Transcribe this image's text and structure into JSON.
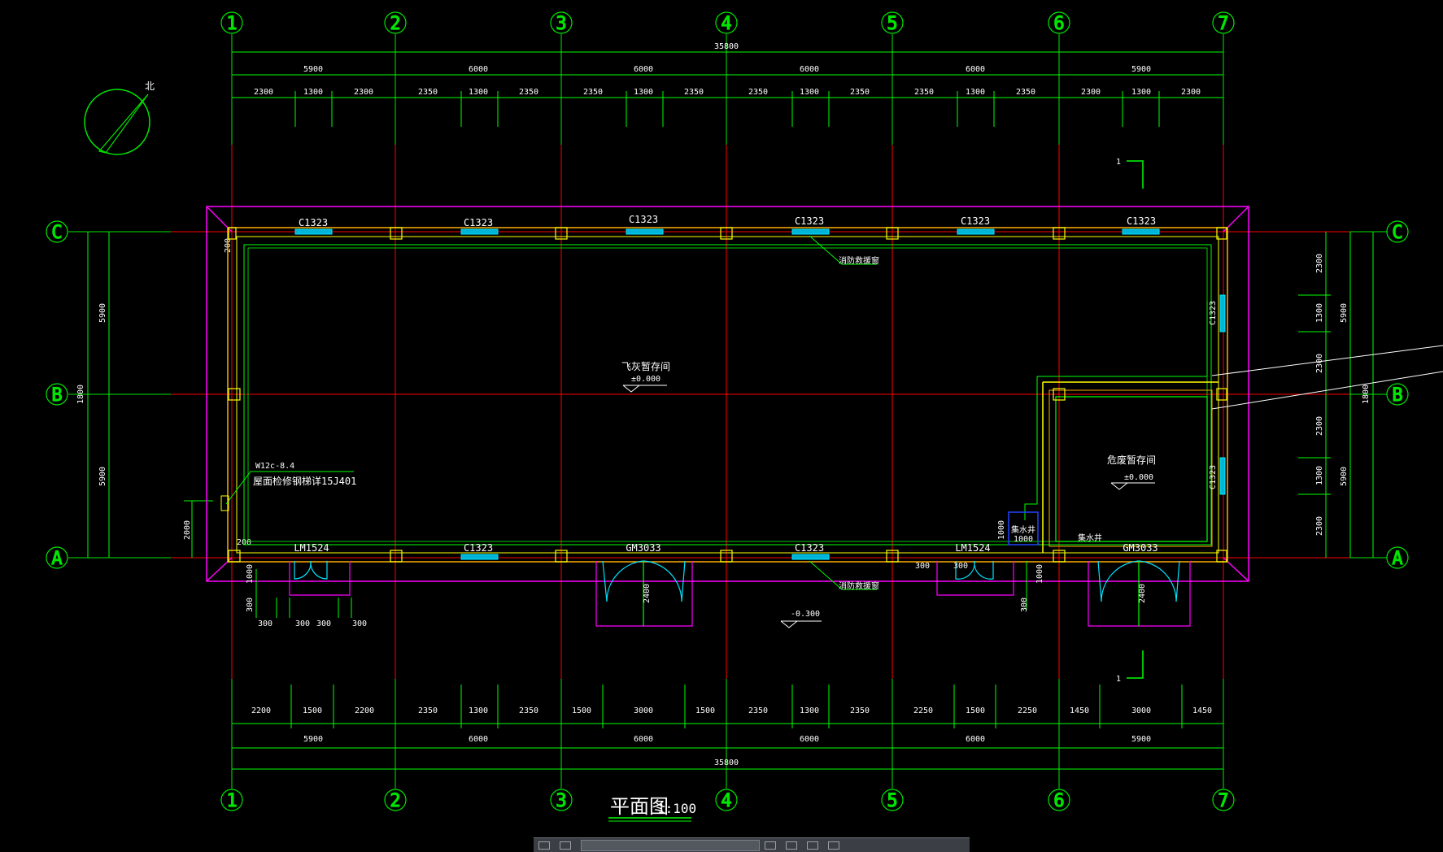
{
  "drawing": {
    "title": "平面图",
    "scale": "1:100",
    "north_label": "北",
    "overall_dim": "35800",
    "grid_x": [
      "1",
      "2",
      "3",
      "4",
      "5",
      "6",
      "7"
    ],
    "grid_y": [
      "C",
      "B",
      "A"
    ],
    "bay_dims": [
      "5900",
      "6000",
      "6000",
      "6000",
      "6000",
      "5900"
    ],
    "top_detail_dims": [
      "2300",
      "1300",
      "2300",
      "2350",
      "1300",
      "2350",
      "2350",
      "1300",
      "2350",
      "2350",
      "1300",
      "2350",
      "2350",
      "1300",
      "2350",
      "2300",
      "1300",
      "2300"
    ],
    "bottom_detail_dims": [
      "2200",
      "1500",
      "2200",
      "2350",
      "1300",
      "2350",
      "1500",
      "3000",
      "1500",
      "2350",
      "1300",
      "2350",
      "2250",
      "1500",
      "2250",
      "1450",
      "3000",
      "1450"
    ],
    "left_dims": [
      "5900",
      "1800",
      "5900",
      "2000",
      "200",
      "200"
    ],
    "right_dims": [
      "2300",
      "1300",
      "2300",
      "5900",
      "1800",
      "2300",
      "1300",
      "2300",
      "5900"
    ],
    "windows_top": [
      "C1323",
      "C1323",
      "C1323",
      "C1323",
      "C1323",
      "C1323"
    ],
    "windows_bottom": [
      "C1323",
      "C1323"
    ],
    "doors": [
      "LM1524",
      "GM3033",
      "LM1524",
      "GM3033"
    ],
    "side_windows": [
      "C1323",
      "C1323"
    ],
    "room_main": "飞灰暂存间",
    "room_main_level": "±0.000",
    "room_side": "危废暂存间",
    "room_side_level": "±0.000",
    "outside_level": "-0.300",
    "notes": [
      "消防救援窗",
      "消防救援窗",
      "W12c-8.4",
      "屋面检修钢梯详15J401",
      "集水井",
      "集水井",
      "1000",
      "1000"
    ],
    "section_mark": "1",
    "small_dims": [
      "1000",
      "300",
      "300",
      "300",
      "300",
      "300",
      "300",
      "1000",
      "300",
      "300",
      "2400",
      "2400"
    ],
    "colors": {
      "grid": "#ff0000",
      "dims": "#00ff00",
      "walls": "#ffff00",
      "outline": "#ff00ff",
      "windows": "#00e5ff",
      "text": "#ffffff",
      "bubble": "#00e600"
    }
  }
}
